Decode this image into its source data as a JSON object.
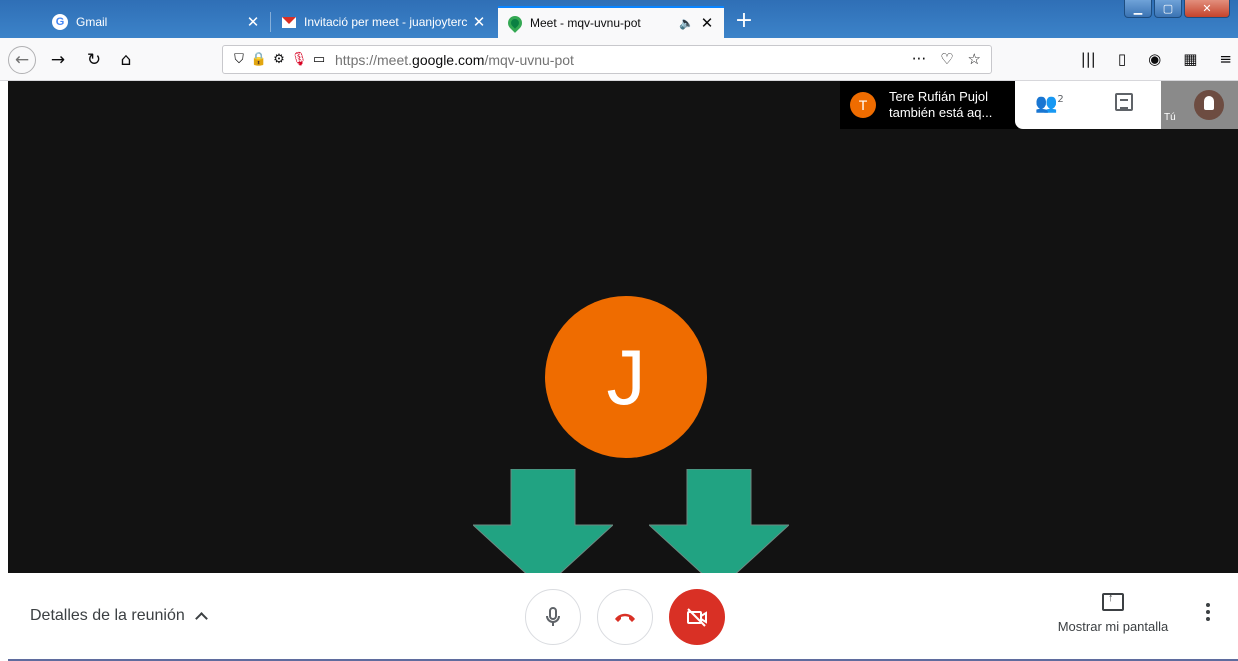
{
  "browser": {
    "tabs": [
      {
        "title": "Gmail",
        "icon": "google-icon",
        "active": false
      },
      {
        "title": "Invitació per meet - juanjoyterc",
        "icon": "gmail-icon",
        "active": false
      },
      {
        "title": "Meet - mqv-uvnu-pot",
        "icon": "meet-icon",
        "active": true,
        "audio": "speaker-icon"
      }
    ],
    "url_prefix": "https://meet.",
    "url_domain": "google.com",
    "url_path": "/mqv-uvnu-pot",
    "colors": {
      "tabstrip": "#2f6fb6",
      "active_tab_accent": "#0a84ff"
    }
  },
  "meet": {
    "main_avatar_letter": "J",
    "avatar_color": "#ef6c00",
    "notification": {
      "avatar_letter": "T",
      "line1": "Tere Rufián Pujol",
      "line2": "también está aq..."
    },
    "participants_count": "2",
    "self_label": "Tú",
    "details_label": "Detalles de la reunión",
    "present_label": "Mostrar mi pantalla",
    "colors": {
      "stage_bg": "#121212",
      "hangup": "#d93025",
      "camera_off_bg": "#d93025",
      "arrow": "#21a382"
    }
  }
}
